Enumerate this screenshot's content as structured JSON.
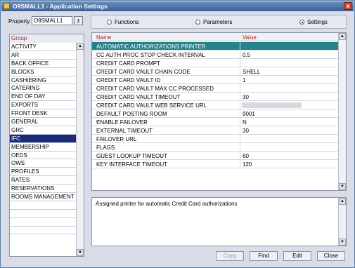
{
  "window": {
    "title": "O9SMALL1 - Application Settings",
    "close_glyph": "x"
  },
  "property": {
    "label": "Property",
    "value": "O9SMALL1",
    "button_glyph": "±"
  },
  "views": [
    {
      "label": "Functions",
      "selected": false
    },
    {
      "label": "Parameters",
      "selected": false
    },
    {
      "label": "Settings",
      "selected": true
    }
  ],
  "group": {
    "header": "Group",
    "items": [
      "ACTIVITY",
      "AR",
      "BACK OFFICE",
      "BLOCKS",
      "CASHIERING",
      "CATERING",
      "END OF DAY",
      "EXPORTS",
      "FRONT DESK",
      "GENERAL",
      "GRC",
      "IFC",
      "MEMBERSHIP",
      "OEDS",
      "OWS",
      "PROFILES",
      "RATES",
      "RESERVATIONS",
      "ROOMS MANAGEMENT",
      "",
      "",
      "",
      ""
    ],
    "selected_index": 11
  },
  "table": {
    "columns": {
      "name": "Name",
      "value": "Value"
    },
    "rows": [
      {
        "name": "AUTOMATIC AUTHORIZATIONS PRINTER",
        "value": ""
      },
      {
        "name": "CC AUTH PROC STOP CHECK INTERVAL",
        "value": "0.5"
      },
      {
        "name": "CREDIT CARD PROMPT",
        "value": ""
      },
      {
        "name": "CREDIT CARD VAULT CHAIN CODE",
        "value": "SHELL"
      },
      {
        "name": "CREDIT CARD VAULT ID",
        "value": "1"
      },
      {
        "name": "CREDIT CARD VAULT MAX CC PROCESSED",
        "value": ""
      },
      {
        "name": "CREDIT CARD VAULT TIMEOUT",
        "value": "30"
      },
      {
        "name": "CREDIT CARD VAULT WEB SERVICE URL",
        "value": ""
      },
      {
        "name": "DEFAULT POSTING ROOM",
        "value": "9001"
      },
      {
        "name": "ENABLE FAILOVER",
        "value": "N"
      },
      {
        "name": "EXTERNAL TIMEOUT",
        "value": "30"
      },
      {
        "name": "FAILOVER URL",
        "value": ""
      },
      {
        "name": "FLAGS",
        "value": ""
      },
      {
        "name": "GUEST LOOKUP TIMEOUT",
        "value": "60"
      },
      {
        "name": "KEY INTERFACE TIMEOUT",
        "value": "120"
      }
    ],
    "selected_index": 0
  },
  "description": "Assigned printer for automatic Credit Card authorizations",
  "buttons": {
    "copy": "Copy",
    "find": "Find",
    "edit": "Edit",
    "close": "Close"
  },
  "colors": {
    "selection_teal": "#22838a",
    "selection_navy": "#1c2a7a",
    "header_red": "#b52020"
  }
}
